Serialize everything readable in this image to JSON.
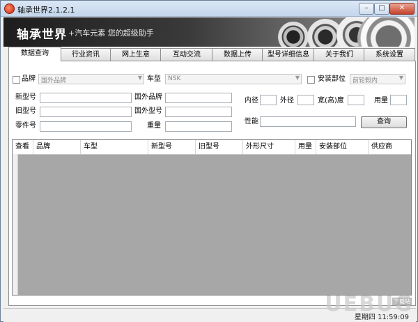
{
  "window": {
    "title": "轴承世界2.1.2.1"
  },
  "banner": {
    "brand": "轴承世界",
    "slogan": "+汽车元素    您的超级助手"
  },
  "tabs": [
    {
      "label": "数据查询",
      "active": true
    },
    {
      "label": "行业资讯"
    },
    {
      "label": "网上生意"
    },
    {
      "label": "互动交流"
    },
    {
      "label": "数据上传"
    },
    {
      "label": "型号详细信息"
    },
    {
      "label": "关于我们"
    },
    {
      "label": "系统设置"
    }
  ],
  "filters": {
    "brand_label": "品牌",
    "brand_value": "国外品牌",
    "car_label": "车型",
    "car_value": "NSK",
    "mount_label": "安装部位",
    "mount_value": "前轮毂内"
  },
  "fields": {
    "new_model": "新型号",
    "foreign_brand": "国外品牌",
    "old_model": "旧型号",
    "foreign_model": "国外型号",
    "part_no": "零件号",
    "weight": "重量",
    "inner_dia": "内径",
    "outer_dia": "外径",
    "width": "宽(高)度",
    "usage": "用量",
    "performance": "性能"
  },
  "search_button": "查询",
  "table": {
    "columns": [
      "查看",
      "品牌",
      "车型",
      "新型号",
      "旧型号",
      "外形尺寸",
      "用量",
      "安装部位",
      "供应商"
    ]
  },
  "status": {
    "time": "星期四 11:59:09"
  },
  "watermark": {
    "text": "UEBUG",
    "tag": "下载站"
  }
}
